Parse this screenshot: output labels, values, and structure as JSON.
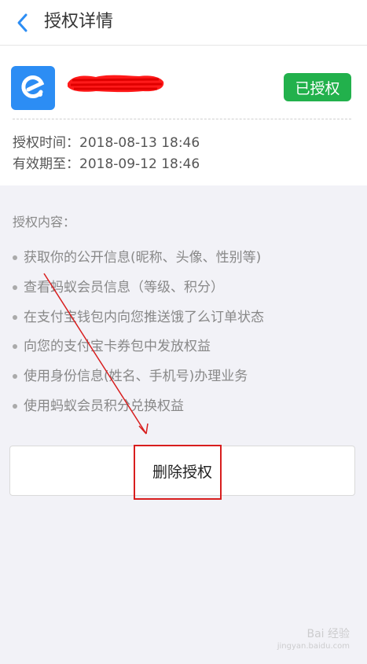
{
  "header": {
    "title": "授权详情"
  },
  "auth": {
    "status_badge": "已授权",
    "auth_time": "授权时间：2018-08-13 18:46",
    "valid_until": "有效期至：2018-09-12 18:46"
  },
  "permissions": {
    "section_label": "授权内容：",
    "items": [
      "获取你的公开信息(昵称、头像、性别等)",
      "查看蚂蚁会员信息（等级、积分）",
      "在支付宝钱包内向您推送饿了么订单状态",
      "向您的支付宝卡券包中发放权益",
      "使用身份信息(姓名、手机号)办理业务",
      "使用蚂蚁会员积分兑换权益"
    ]
  },
  "actions": {
    "delete_label": "删除授权"
  },
  "watermark": {
    "text": "Bai 经验",
    "subtext": "jingyan.baidu.com"
  },
  "colors": {
    "accent": "#2C8DF4",
    "badge_green": "#22B14C",
    "annotation_red": "#D81E1E",
    "background": "#F2F2F7"
  },
  "icons": {
    "back": "chevron-left-icon",
    "app": "eleme-icon"
  }
}
